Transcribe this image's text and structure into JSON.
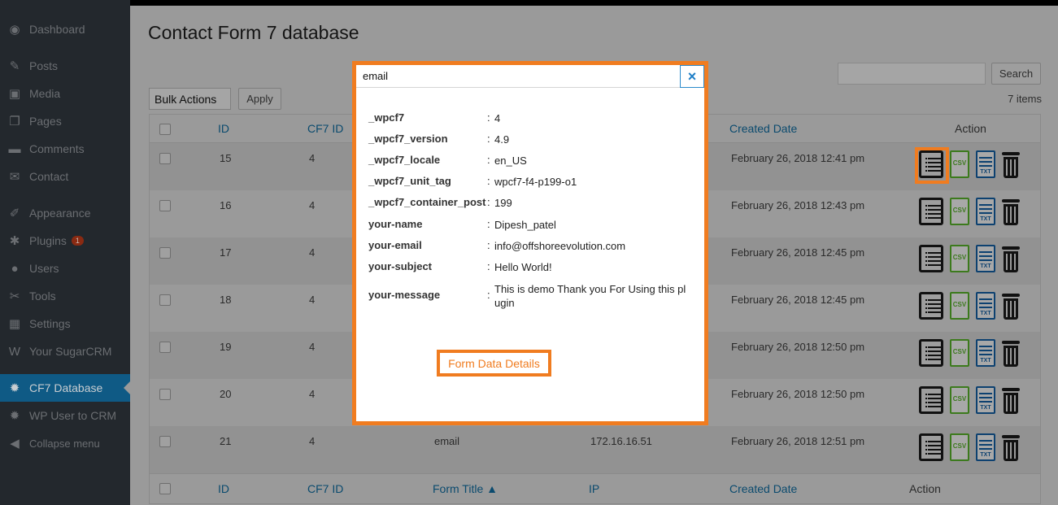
{
  "sidebar": {
    "items": [
      {
        "label": "Dashboard",
        "icon": "dashboard-icon",
        "glyph": "◉"
      },
      {
        "label": "Posts",
        "icon": "pin-icon",
        "glyph": "✎"
      },
      {
        "label": "Media",
        "icon": "media-icon",
        "glyph": "▣"
      },
      {
        "label": "Pages",
        "icon": "pages-icon",
        "glyph": "❐"
      },
      {
        "label": "Comments",
        "icon": "comments-icon",
        "glyph": "▬"
      },
      {
        "label": "Contact",
        "icon": "mail-icon",
        "glyph": "✉"
      },
      {
        "label": "Appearance",
        "icon": "brush-icon",
        "glyph": "✐"
      },
      {
        "label": "Plugins",
        "icon": "plug-icon",
        "glyph": "✱",
        "badge": "1"
      },
      {
        "label": "Users",
        "icon": "user-icon",
        "glyph": "●"
      },
      {
        "label": "Tools",
        "icon": "wrench-icon",
        "glyph": "✂"
      },
      {
        "label": "Settings",
        "icon": "settings-icon",
        "glyph": "▦"
      },
      {
        "label": "Your SugarCRM",
        "icon": "ws-icon",
        "glyph": "W"
      },
      {
        "label": "CF7 Database",
        "icon": "gear-icon",
        "glyph": "✹"
      },
      {
        "label": "WP User to CRM",
        "icon": "gear-icon",
        "glyph": "✹"
      },
      {
        "label": "Collapse menu",
        "icon": "collapse-icon",
        "glyph": "◀"
      }
    ]
  },
  "page": {
    "title": "Contact Form 7 database",
    "search_button": "Search",
    "bulk_actions": "Bulk Actions",
    "apply_button": "Apply",
    "items_count": "7 items"
  },
  "table": {
    "headers": {
      "id": "ID",
      "cf7_id": "CF7 ID",
      "form_title": "Form Title ▲",
      "ip": "IP",
      "created_date": "Created Date",
      "action": "Action"
    },
    "rows": [
      {
        "id": "15",
        "cf7_id": "4",
        "form_title": "",
        "ip": "",
        "date": "February 26, 2018 12:41 pm"
      },
      {
        "id": "16",
        "cf7_id": "4",
        "form_title": "",
        "ip": "",
        "date": "February 26, 2018 12:43 pm"
      },
      {
        "id": "17",
        "cf7_id": "4",
        "form_title": "",
        "ip": "",
        "date": "February 26, 2018 12:45 pm"
      },
      {
        "id": "18",
        "cf7_id": "4",
        "form_title": "",
        "ip": "",
        "date": "February 26, 2018 12:45 pm"
      },
      {
        "id": "19",
        "cf7_id": "4",
        "form_title": "",
        "ip": "",
        "date": "February 26, 2018 12:50 pm"
      },
      {
        "id": "20",
        "cf7_id": "4",
        "form_title": "",
        "ip": "",
        "date": "February 26, 2018 12:50 pm"
      },
      {
        "id": "21",
        "cf7_id": "4",
        "form_title": "email",
        "ip": "172.16.16.51",
        "date": "February 26, 2018 12:51 pm"
      }
    ],
    "icons": {
      "csv": "CSV",
      "txt": "TXT"
    }
  },
  "modal": {
    "title": "email",
    "close": "×",
    "fields": [
      {
        "key": "_wpcf7",
        "value": "4"
      },
      {
        "key": "_wpcf7_version",
        "value": "4.9"
      },
      {
        "key": "_wpcf7_locale",
        "value": "en_US"
      },
      {
        "key": "_wpcf7_unit_tag",
        "value": "wpcf7-f4-p199-o1"
      },
      {
        "key": "_wpcf7_container_post",
        "value": "199"
      },
      {
        "key": "your-name",
        "value": "Dipesh_patel"
      },
      {
        "key": "your-email",
        "value": "info@offshoreevolution.com"
      },
      {
        "key": "your-subject",
        "value": "Hello World!"
      },
      {
        "key": "your-message",
        "value": "This is demo Thank you For Using this pl ugin"
      }
    ],
    "link_label": "Form Data Details"
  }
}
